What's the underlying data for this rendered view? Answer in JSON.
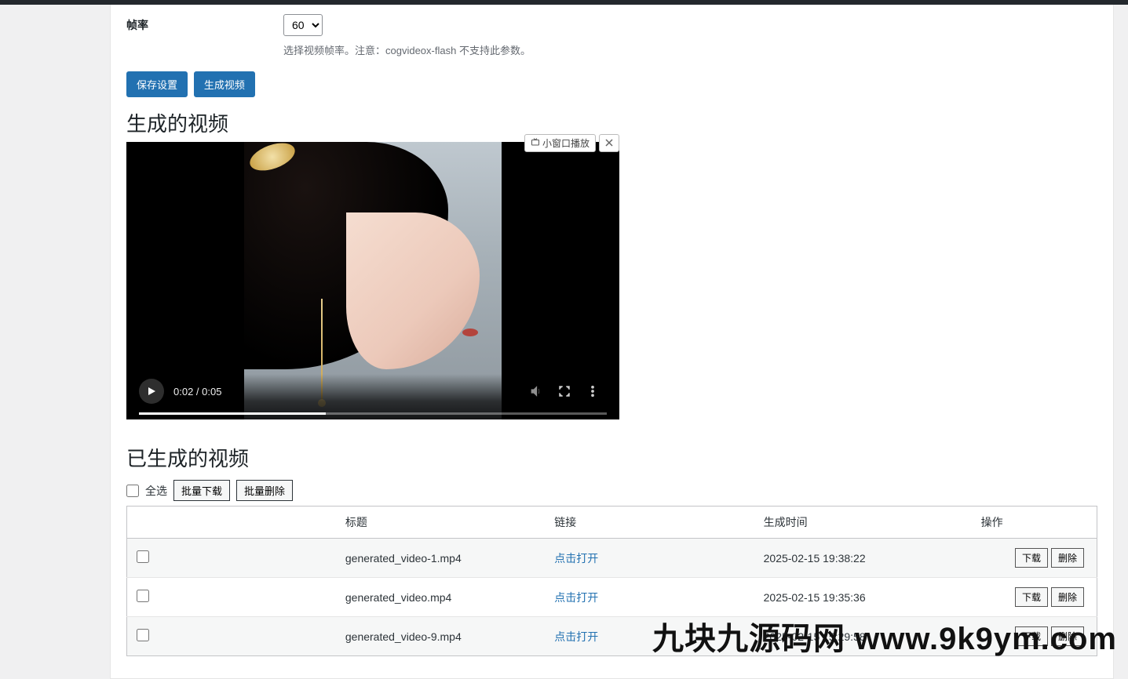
{
  "form": {
    "framerate_label": "帧率",
    "framerate_value": "60",
    "framerate_desc": "选择视频帧率。注意：cogvideox-flash 不支持此参数。"
  },
  "buttons": {
    "save": "保存设置",
    "generate": "生成视频",
    "pip": "小窗口播放",
    "select_all": "全选",
    "bulk_download": "批量下载",
    "bulk_delete": "批量删除",
    "download": "下载",
    "delete": "删除",
    "open_link": "点击打开"
  },
  "sections": {
    "generated_video": "生成的视频",
    "video_list": "已生成的视频"
  },
  "player": {
    "time": "0:02 / 0:05"
  },
  "table": {
    "headers": {
      "title": "标题",
      "link": "链接",
      "time": "生成时间",
      "ops": "操作"
    },
    "rows": [
      {
        "title": "generated_video-1.mp4",
        "time": "2025-02-15 19:38:22"
      },
      {
        "title": "generated_video.mp4",
        "time": "2025-02-15 19:35:36"
      },
      {
        "title": "generated_video-9.mp4",
        "time": "2025-02-15 15:29:58"
      }
    ]
  },
  "watermark": "九块九源码网 www.9k9ym.com"
}
